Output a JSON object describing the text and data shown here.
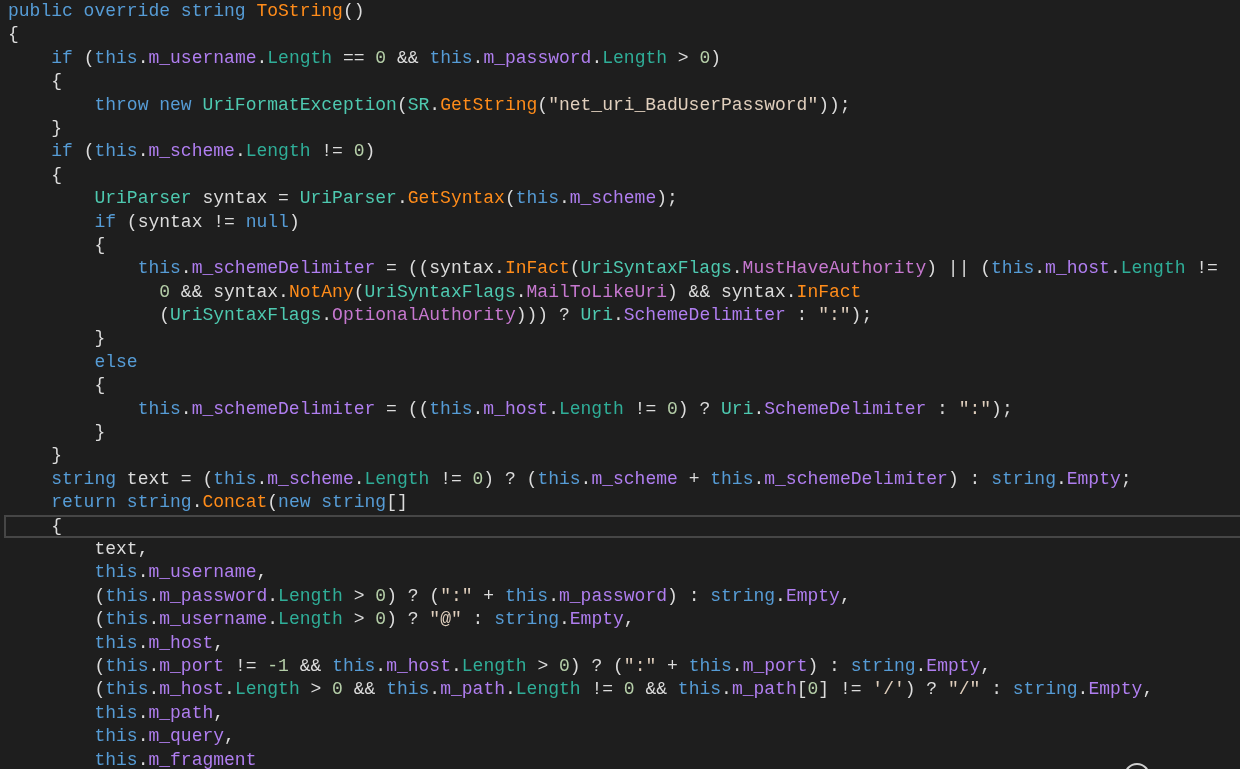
{
  "editor": {
    "lines": [
      {
        "current": false,
        "tokens": [
          {
            "kind": "keyword",
            "text": "public override string "
          },
          {
            "kind": "method",
            "text": "ToString"
          },
          {
            "kind": "plain",
            "text": "()"
          }
        ]
      },
      {
        "current": false,
        "tokens": [
          {
            "kind": "plain",
            "text": "{"
          }
        ]
      },
      {
        "current": false,
        "tokens": [
          {
            "kind": "keyword",
            "text": "    if"
          },
          {
            "kind": "plain",
            "text": " ("
          },
          {
            "kind": "keyword",
            "text": "this"
          },
          {
            "kind": "plain",
            "text": "."
          },
          {
            "kind": "field",
            "text": "m_username"
          },
          {
            "kind": "plain",
            "text": "."
          },
          {
            "kind": "property",
            "text": "Length"
          },
          {
            "kind": "plain",
            "text": " == "
          },
          {
            "kind": "number",
            "text": "0"
          },
          {
            "kind": "plain",
            "text": " && "
          },
          {
            "kind": "keyword",
            "text": "this"
          },
          {
            "kind": "plain",
            "text": "."
          },
          {
            "kind": "field",
            "text": "m_password"
          },
          {
            "kind": "plain",
            "text": "."
          },
          {
            "kind": "property",
            "text": "Length"
          },
          {
            "kind": "plain",
            "text": " > "
          },
          {
            "kind": "number",
            "text": "0"
          },
          {
            "kind": "plain",
            "text": ")"
          }
        ]
      },
      {
        "current": false,
        "tokens": [
          {
            "kind": "plain",
            "text": "    {"
          }
        ]
      },
      {
        "current": false,
        "tokens": [
          {
            "kind": "keyword",
            "text": "        throw new "
          },
          {
            "kind": "type",
            "text": "UriFormatException"
          },
          {
            "kind": "plain",
            "text": "("
          },
          {
            "kind": "type",
            "text": "SR"
          },
          {
            "kind": "plain",
            "text": "."
          },
          {
            "kind": "method",
            "text": "GetString"
          },
          {
            "kind": "plain",
            "text": "("
          },
          {
            "kind": "string",
            "text": "\"net_uri_BadUserPassword\""
          },
          {
            "kind": "plain",
            "text": "));"
          }
        ]
      },
      {
        "current": false,
        "tokens": [
          {
            "kind": "plain",
            "text": "    }"
          }
        ]
      },
      {
        "current": false,
        "tokens": [
          {
            "kind": "keyword",
            "text": "    if"
          },
          {
            "kind": "plain",
            "text": " ("
          },
          {
            "kind": "keyword",
            "text": "this"
          },
          {
            "kind": "plain",
            "text": "."
          },
          {
            "kind": "field",
            "text": "m_scheme"
          },
          {
            "kind": "plain",
            "text": "."
          },
          {
            "kind": "property",
            "text": "Length"
          },
          {
            "kind": "plain",
            "text": " != "
          },
          {
            "kind": "number",
            "text": "0"
          },
          {
            "kind": "plain",
            "text": ")"
          }
        ]
      },
      {
        "current": false,
        "tokens": [
          {
            "kind": "plain",
            "text": "    {"
          }
        ]
      },
      {
        "current": false,
        "tokens": [
          {
            "kind": "type",
            "text": "        UriParser"
          },
          {
            "kind": "plain",
            "text": " syntax = "
          },
          {
            "kind": "type",
            "text": "UriParser"
          },
          {
            "kind": "plain",
            "text": "."
          },
          {
            "kind": "method",
            "text": "GetSyntax"
          },
          {
            "kind": "plain",
            "text": "("
          },
          {
            "kind": "keyword",
            "text": "this"
          },
          {
            "kind": "plain",
            "text": "."
          },
          {
            "kind": "field",
            "text": "m_scheme"
          },
          {
            "kind": "plain",
            "text": ");"
          }
        ]
      },
      {
        "current": false,
        "tokens": [
          {
            "kind": "keyword",
            "text": "        if"
          },
          {
            "kind": "plain",
            "text": " (syntax != "
          },
          {
            "kind": "keyword",
            "text": "null"
          },
          {
            "kind": "plain",
            "text": ")"
          }
        ]
      },
      {
        "current": false,
        "tokens": [
          {
            "kind": "plain",
            "text": "        {"
          }
        ]
      },
      {
        "current": false,
        "tokens": [
          {
            "kind": "keyword",
            "text": "            this"
          },
          {
            "kind": "plain",
            "text": "."
          },
          {
            "kind": "field",
            "text": "m_schemeDelimiter"
          },
          {
            "kind": "plain",
            "text": " = ((syntax."
          },
          {
            "kind": "method",
            "text": "InFact"
          },
          {
            "kind": "plain",
            "text": "("
          },
          {
            "kind": "type",
            "text": "UriSyntaxFlags"
          },
          {
            "kind": "plain",
            "text": "."
          },
          {
            "kind": "enum",
            "text": "MustHaveAuthority"
          },
          {
            "kind": "plain",
            "text": ") || ("
          },
          {
            "kind": "keyword",
            "text": "this"
          },
          {
            "kind": "plain",
            "text": "."
          },
          {
            "kind": "field",
            "text": "m_host"
          },
          {
            "kind": "plain",
            "text": "."
          },
          {
            "kind": "property",
            "text": "Length"
          },
          {
            "kind": "plain",
            "text": " !="
          }
        ]
      },
      {
        "current": false,
        "tokens": [
          {
            "kind": "number",
            "text": "              0"
          },
          {
            "kind": "plain",
            "text": " && syntax."
          },
          {
            "kind": "method",
            "text": "NotAny"
          },
          {
            "kind": "plain",
            "text": "("
          },
          {
            "kind": "type",
            "text": "UriSyntaxFlags"
          },
          {
            "kind": "plain",
            "text": "."
          },
          {
            "kind": "enum",
            "text": "MailToLikeUri"
          },
          {
            "kind": "plain",
            "text": ") && syntax."
          },
          {
            "kind": "method",
            "text": "InFact"
          }
        ]
      },
      {
        "current": false,
        "tokens": [
          {
            "kind": "plain",
            "text": "              ("
          },
          {
            "kind": "type",
            "text": "UriSyntaxFlags"
          },
          {
            "kind": "plain",
            "text": "."
          },
          {
            "kind": "enum",
            "text": "OptionalAuthority"
          },
          {
            "kind": "plain",
            "text": "))) ? "
          },
          {
            "kind": "type",
            "text": "Uri"
          },
          {
            "kind": "plain",
            "text": "."
          },
          {
            "kind": "field",
            "text": "SchemeDelimiter"
          },
          {
            "kind": "plain",
            "text": " : "
          },
          {
            "kind": "string",
            "text": "\":\""
          },
          {
            "kind": "plain",
            "text": ");"
          }
        ]
      },
      {
        "current": false,
        "tokens": [
          {
            "kind": "plain",
            "text": "        }"
          }
        ]
      },
      {
        "current": false,
        "tokens": [
          {
            "kind": "keyword",
            "text": "        else"
          }
        ]
      },
      {
        "current": false,
        "tokens": [
          {
            "kind": "plain",
            "text": "        {"
          }
        ]
      },
      {
        "current": false,
        "tokens": [
          {
            "kind": "keyword",
            "text": "            this"
          },
          {
            "kind": "plain",
            "text": "."
          },
          {
            "kind": "field",
            "text": "m_schemeDelimiter"
          },
          {
            "kind": "plain",
            "text": " = (("
          },
          {
            "kind": "keyword",
            "text": "this"
          },
          {
            "kind": "plain",
            "text": "."
          },
          {
            "kind": "field",
            "text": "m_host"
          },
          {
            "kind": "plain",
            "text": "."
          },
          {
            "kind": "property",
            "text": "Length"
          },
          {
            "kind": "plain",
            "text": " != "
          },
          {
            "kind": "number",
            "text": "0"
          },
          {
            "kind": "plain",
            "text": ") ? "
          },
          {
            "kind": "type",
            "text": "Uri"
          },
          {
            "kind": "plain",
            "text": "."
          },
          {
            "kind": "field",
            "text": "SchemeDelimiter"
          },
          {
            "kind": "plain",
            "text": " : "
          },
          {
            "kind": "string",
            "text": "\":\""
          },
          {
            "kind": "plain",
            "text": ");"
          }
        ]
      },
      {
        "current": false,
        "tokens": [
          {
            "kind": "plain",
            "text": "        }"
          }
        ]
      },
      {
        "current": false,
        "tokens": [
          {
            "kind": "plain",
            "text": "    }"
          }
        ]
      },
      {
        "current": false,
        "tokens": [
          {
            "kind": "keyword",
            "text": "    string"
          },
          {
            "kind": "plain",
            "text": " text = ("
          },
          {
            "kind": "keyword",
            "text": "this"
          },
          {
            "kind": "plain",
            "text": "."
          },
          {
            "kind": "field",
            "text": "m_scheme"
          },
          {
            "kind": "plain",
            "text": "."
          },
          {
            "kind": "property",
            "text": "Length"
          },
          {
            "kind": "plain",
            "text": " != "
          },
          {
            "kind": "number",
            "text": "0"
          },
          {
            "kind": "plain",
            "text": ") ? ("
          },
          {
            "kind": "keyword",
            "text": "this"
          },
          {
            "kind": "plain",
            "text": "."
          },
          {
            "kind": "field",
            "text": "m_scheme"
          },
          {
            "kind": "plain",
            "text": " + "
          },
          {
            "kind": "keyword",
            "text": "this"
          },
          {
            "kind": "plain",
            "text": "."
          },
          {
            "kind": "field",
            "text": "m_schemeDelimiter"
          },
          {
            "kind": "plain",
            "text": ") : "
          },
          {
            "kind": "keyword",
            "text": "string"
          },
          {
            "kind": "plain",
            "text": "."
          },
          {
            "kind": "field",
            "text": "Empty"
          },
          {
            "kind": "plain",
            "text": ";"
          }
        ]
      },
      {
        "current": false,
        "tokens": [
          {
            "kind": "keyword",
            "text": "    return string"
          },
          {
            "kind": "plain",
            "text": "."
          },
          {
            "kind": "method",
            "text": "Concat"
          },
          {
            "kind": "plain",
            "text": "("
          },
          {
            "kind": "keyword",
            "text": "new string"
          },
          {
            "kind": "plain",
            "text": "[]"
          }
        ]
      },
      {
        "current": true,
        "tokens": [
          {
            "kind": "plain",
            "text": "    {"
          }
        ]
      },
      {
        "current": false,
        "tokens": [
          {
            "kind": "plain",
            "text": "        text,"
          }
        ]
      },
      {
        "current": false,
        "tokens": [
          {
            "kind": "keyword",
            "text": "        this"
          },
          {
            "kind": "plain",
            "text": "."
          },
          {
            "kind": "field",
            "text": "m_username"
          },
          {
            "kind": "plain",
            "text": ","
          }
        ]
      },
      {
        "current": false,
        "tokens": [
          {
            "kind": "plain",
            "text": "        ("
          },
          {
            "kind": "keyword",
            "text": "this"
          },
          {
            "kind": "plain",
            "text": "."
          },
          {
            "kind": "field",
            "text": "m_password"
          },
          {
            "kind": "plain",
            "text": "."
          },
          {
            "kind": "property",
            "text": "Length"
          },
          {
            "kind": "plain",
            "text": " > "
          },
          {
            "kind": "number",
            "text": "0"
          },
          {
            "kind": "plain",
            "text": ") ? ("
          },
          {
            "kind": "string",
            "text": "\":\""
          },
          {
            "kind": "plain",
            "text": " + "
          },
          {
            "kind": "keyword",
            "text": "this"
          },
          {
            "kind": "plain",
            "text": "."
          },
          {
            "kind": "field",
            "text": "m_password"
          },
          {
            "kind": "plain",
            "text": ") : "
          },
          {
            "kind": "keyword",
            "text": "string"
          },
          {
            "kind": "plain",
            "text": "."
          },
          {
            "kind": "field",
            "text": "Empty"
          },
          {
            "kind": "plain",
            "text": ","
          }
        ]
      },
      {
        "current": false,
        "tokens": [
          {
            "kind": "plain",
            "text": "        ("
          },
          {
            "kind": "keyword",
            "text": "this"
          },
          {
            "kind": "plain",
            "text": "."
          },
          {
            "kind": "field",
            "text": "m_username"
          },
          {
            "kind": "plain",
            "text": "."
          },
          {
            "kind": "property",
            "text": "Length"
          },
          {
            "kind": "plain",
            "text": " > "
          },
          {
            "kind": "number",
            "text": "0"
          },
          {
            "kind": "plain",
            "text": ") ? "
          },
          {
            "kind": "string",
            "text": "\"@\""
          },
          {
            "kind": "plain",
            "text": " : "
          },
          {
            "kind": "keyword",
            "text": "string"
          },
          {
            "kind": "plain",
            "text": "."
          },
          {
            "kind": "field",
            "text": "Empty"
          },
          {
            "kind": "plain",
            "text": ","
          }
        ]
      },
      {
        "current": false,
        "tokens": [
          {
            "kind": "keyword",
            "text": "        this"
          },
          {
            "kind": "plain",
            "text": "."
          },
          {
            "kind": "field",
            "text": "m_host"
          },
          {
            "kind": "plain",
            "text": ","
          }
        ]
      },
      {
        "current": false,
        "tokens": [
          {
            "kind": "plain",
            "text": "        ("
          },
          {
            "kind": "keyword",
            "text": "this"
          },
          {
            "kind": "plain",
            "text": "."
          },
          {
            "kind": "field",
            "text": "m_port"
          },
          {
            "kind": "plain",
            "text": " != "
          },
          {
            "kind": "number",
            "text": "-1"
          },
          {
            "kind": "plain",
            "text": " && "
          },
          {
            "kind": "keyword",
            "text": "this"
          },
          {
            "kind": "plain",
            "text": "."
          },
          {
            "kind": "field",
            "text": "m_host"
          },
          {
            "kind": "plain",
            "text": "."
          },
          {
            "kind": "property",
            "text": "Length"
          },
          {
            "kind": "plain",
            "text": " > "
          },
          {
            "kind": "number",
            "text": "0"
          },
          {
            "kind": "plain",
            "text": ") ? ("
          },
          {
            "kind": "string",
            "text": "\":\""
          },
          {
            "kind": "plain",
            "text": " + "
          },
          {
            "kind": "keyword",
            "text": "this"
          },
          {
            "kind": "plain",
            "text": "."
          },
          {
            "kind": "field",
            "text": "m_port"
          },
          {
            "kind": "plain",
            "text": ") : "
          },
          {
            "kind": "keyword",
            "text": "string"
          },
          {
            "kind": "plain",
            "text": "."
          },
          {
            "kind": "field",
            "text": "Empty"
          },
          {
            "kind": "plain",
            "text": ","
          }
        ]
      },
      {
        "current": false,
        "tokens": [
          {
            "kind": "plain",
            "text": "        ("
          },
          {
            "kind": "keyword",
            "text": "this"
          },
          {
            "kind": "plain",
            "text": "."
          },
          {
            "kind": "field",
            "text": "m_host"
          },
          {
            "kind": "plain",
            "text": "."
          },
          {
            "kind": "property",
            "text": "Length"
          },
          {
            "kind": "plain",
            "text": " > "
          },
          {
            "kind": "number",
            "text": "0"
          },
          {
            "kind": "plain",
            "text": " && "
          },
          {
            "kind": "keyword",
            "text": "this"
          },
          {
            "kind": "plain",
            "text": "."
          },
          {
            "kind": "field",
            "text": "m_path"
          },
          {
            "kind": "plain",
            "text": "."
          },
          {
            "kind": "property",
            "text": "Length"
          },
          {
            "kind": "plain",
            "text": " != "
          },
          {
            "kind": "number",
            "text": "0"
          },
          {
            "kind": "plain",
            "text": " && "
          },
          {
            "kind": "keyword",
            "text": "this"
          },
          {
            "kind": "plain",
            "text": "."
          },
          {
            "kind": "field",
            "text": "m_path"
          },
          {
            "kind": "plain",
            "text": "["
          },
          {
            "kind": "number",
            "text": "0"
          },
          {
            "kind": "plain",
            "text": "] != "
          },
          {
            "kind": "string",
            "text": "'/'"
          },
          {
            "kind": "plain",
            "text": ") ? "
          },
          {
            "kind": "string",
            "text": "\"/\""
          },
          {
            "kind": "plain",
            "text": " : "
          },
          {
            "kind": "keyword",
            "text": "string"
          },
          {
            "kind": "plain",
            "text": "."
          },
          {
            "kind": "field",
            "text": "Empty"
          },
          {
            "kind": "plain",
            "text": ","
          }
        ]
      },
      {
        "current": false,
        "tokens": [
          {
            "kind": "keyword",
            "text": "        this"
          },
          {
            "kind": "plain",
            "text": "."
          },
          {
            "kind": "field",
            "text": "m_path"
          },
          {
            "kind": "plain",
            "text": ","
          }
        ]
      },
      {
        "current": false,
        "tokens": [
          {
            "kind": "keyword",
            "text": "        this"
          },
          {
            "kind": "plain",
            "text": "."
          },
          {
            "kind": "field",
            "text": "m_query"
          },
          {
            "kind": "plain",
            "text": ","
          }
        ]
      },
      {
        "current": false,
        "tokens": [
          {
            "kind": "keyword",
            "text": "        this"
          },
          {
            "kind": "plain",
            "text": "."
          },
          {
            "kind": "field",
            "text": "m_fragment"
          }
        ]
      }
    ]
  }
}
